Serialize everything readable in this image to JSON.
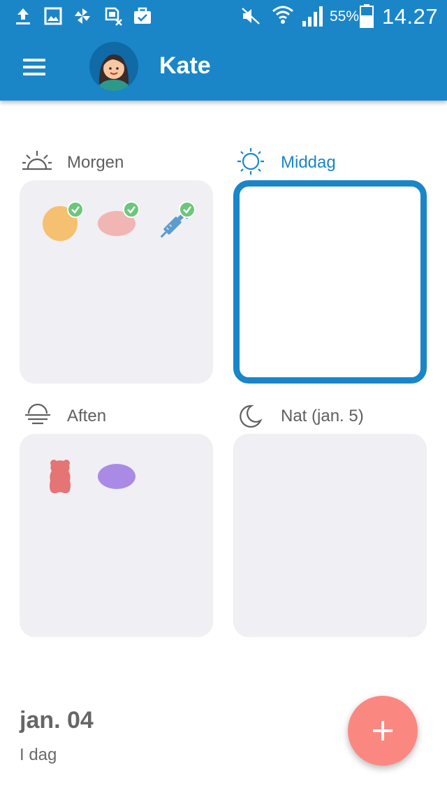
{
  "status_bar": {
    "battery_percent": "55%",
    "time": "14.27",
    "icons": [
      "upload-icon",
      "image-icon",
      "pinwheel-icon",
      "sim-blocked-icon",
      "briefcase-check-icon",
      "mute-icon",
      "wifi-icon",
      "signal-icon",
      "battery-icon"
    ]
  },
  "app_bar": {
    "menu_icon": "hamburger-menu-icon",
    "user_name": "Kate"
  },
  "sections": [
    {
      "label": "Morgen",
      "icon": "sunrise-icon",
      "active": false,
      "items": [
        {
          "icon": "round-pill-icon",
          "color": "#f5c06f",
          "taken": true
        },
        {
          "icon": "oval-pill-icon",
          "color": "#f1b5b3",
          "taken": true
        },
        {
          "icon": "syringe-icon",
          "color": "#5b9ccd",
          "taken": true
        }
      ]
    },
    {
      "label": "Middag",
      "icon": "sun-icon",
      "active": true,
      "items": []
    },
    {
      "label": "Aften",
      "icon": "sunset-icon",
      "active": false,
      "items": [
        {
          "icon": "gummy-bear-icon",
          "color": "#e57474",
          "taken": false
        },
        {
          "icon": "oval-pill-icon",
          "color": "#a98be6",
          "taken": false
        }
      ]
    },
    {
      "label": "Nat (jan. 5)",
      "icon": "moon-icon",
      "active": false,
      "items": []
    }
  ],
  "footer": {
    "date": "jan. 04",
    "relative": "I dag"
  },
  "fab": {
    "icon": "plus-icon",
    "color": "#fb8880"
  },
  "colors": {
    "primary": "#1a86c8",
    "slot_bg": "#efeff4",
    "check": "#6cc77a"
  }
}
